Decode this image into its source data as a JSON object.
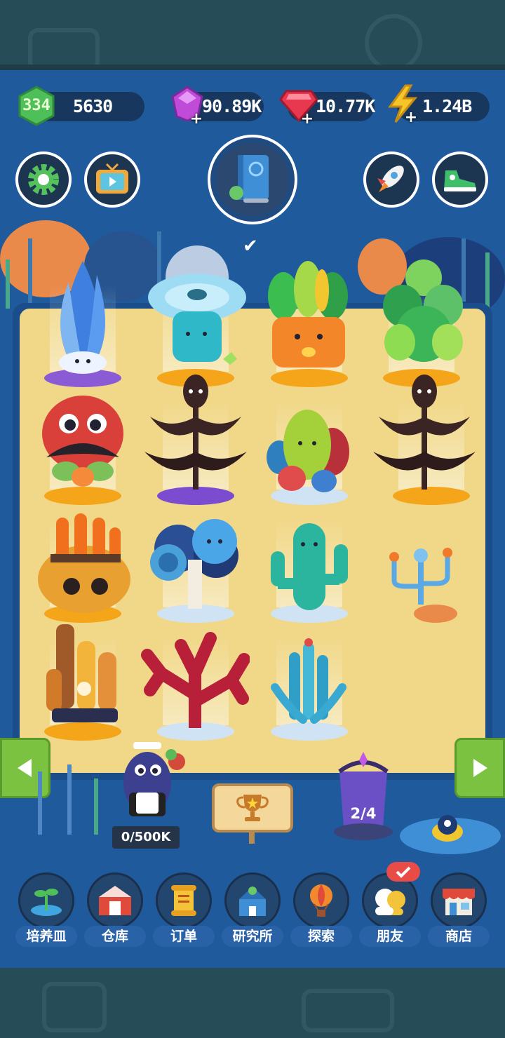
{
  "resources": {
    "level": "334",
    "leaves": "5630",
    "purple_gems": "90.89K",
    "red_gems": "10.77K",
    "energy": "1.24B"
  },
  "counters": {
    "visitor_progress": "0/500K",
    "portal_progress": "2/4"
  },
  "nav": [
    {
      "label": "培养皿",
      "icon": "sprout-icon"
    },
    {
      "label": "仓库",
      "icon": "barn-icon"
    },
    {
      "label": "订单",
      "icon": "scroll-icon"
    },
    {
      "label": "研究所",
      "icon": "lab-icon"
    },
    {
      "label": "探索",
      "icon": "balloon-icon"
    },
    {
      "label": "朋友",
      "icon": "friends-icon"
    },
    {
      "label": "商店",
      "icon": "shop-icon"
    }
  ],
  "colors": {
    "accent_green": "#7ac23f",
    "resource_bar": "#17375f",
    "sand": "#f1d889",
    "notification_red": "#e94b46"
  }
}
